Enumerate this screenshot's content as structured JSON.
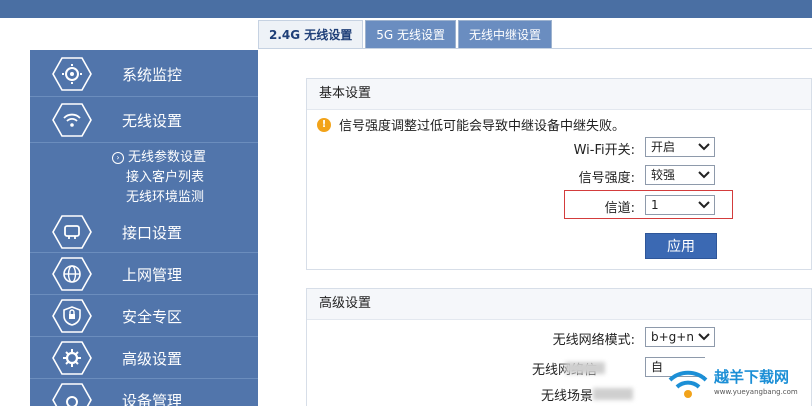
{
  "tabs": [
    {
      "label": "2.4G 无线设置",
      "active": true
    },
    {
      "label": "5G 无线设置",
      "active": false
    },
    {
      "label": "无线中继设置",
      "active": false
    }
  ],
  "sidebar": {
    "items": [
      {
        "label": "系统监控",
        "icon": "gear-monitor-icon"
      },
      {
        "label": "无线设置",
        "icon": "wifi-gear-icon"
      },
      {
        "label": "接口设置",
        "icon": "interface-icon"
      },
      {
        "label": "上网管理",
        "icon": "globe-icon"
      },
      {
        "label": "安全专区",
        "icon": "lock-shield-icon"
      },
      {
        "label": "高级设置",
        "icon": "gear-icon"
      },
      {
        "label": "设备管理",
        "icon": "device-gear-icon"
      }
    ],
    "submenu": [
      {
        "label": "无线参数设置",
        "selected": true
      },
      {
        "label": "接入客户列表",
        "selected": false
      },
      {
        "label": "无线环境监测",
        "selected": false
      }
    ]
  },
  "basic": {
    "title": "基本设置",
    "warning": "信号强度调整过低可能会导致中继设备中继失败。",
    "wifi_label": "Wi-Fi开关:",
    "wifi_value": "开启",
    "signal_label": "信号强度:",
    "signal_value": "较强",
    "channel_label": "信道:",
    "channel_value": "1",
    "apply_label": "应用"
  },
  "advanced": {
    "title": "高级设置",
    "mode_label": "无线网络模式:",
    "mode_value": "b+g+n",
    "row2_label": "无线网络信",
    "row2_value": "自",
    "row3_label": "无线场景"
  },
  "watermark": {
    "text": "越羊下载网",
    "url": "www.yueyangbang.com"
  },
  "colors": {
    "sidebar": "#5175ab",
    "accent": "#3b69b3",
    "highlight": "#d33c3c",
    "warning": "#f2a31a"
  }
}
